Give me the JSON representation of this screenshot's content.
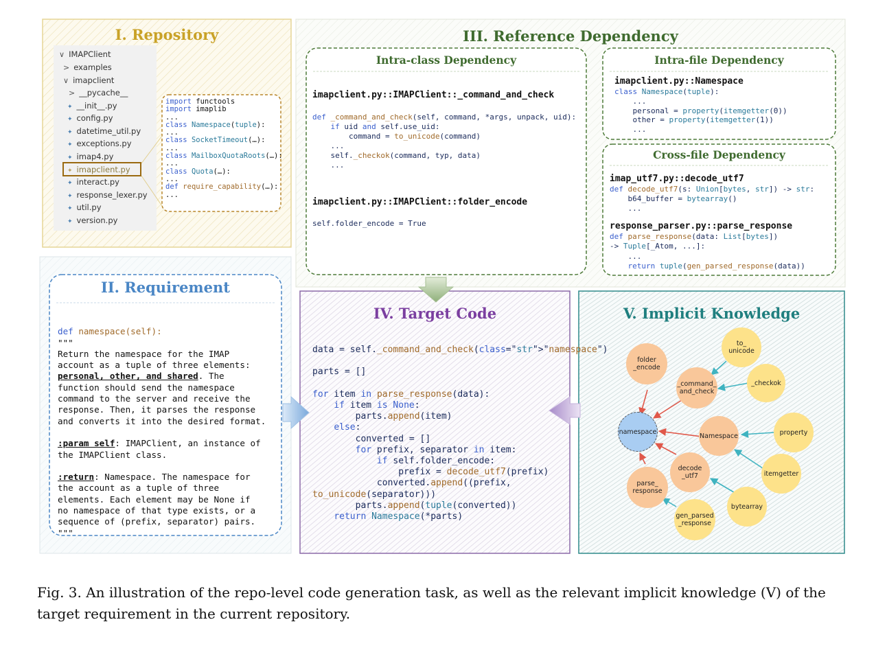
{
  "panels": {
    "repository": {
      "title": "I. Repository"
    },
    "requirement": {
      "title": "II. Requirement"
    },
    "reference": {
      "title": "III. Reference Dependency"
    },
    "target": {
      "title": "IV. Target Code"
    },
    "implicit": {
      "title": "V. Implicit Knowledge"
    }
  },
  "repo_tree": [
    {
      "label": "IMAPClient",
      "prefix": "∨"
    },
    {
      "label": "examples",
      "prefix": ">"
    },
    {
      "label": "imapclient",
      "prefix": "∨"
    },
    {
      "label": "__pycache__",
      "prefix": ">"
    },
    {
      "label": "__init__.py",
      "prefix": "✦"
    },
    {
      "label": "config.py",
      "prefix": "✦"
    },
    {
      "label": "datetime_util.py",
      "prefix": "✦"
    },
    {
      "label": "exceptions.py",
      "prefix": "✦"
    },
    {
      "label": "imap4.py",
      "prefix": "✦"
    },
    {
      "label": "imapclient.py",
      "prefix": "✦"
    },
    {
      "label": "interact.py",
      "prefix": "✦"
    },
    {
      "label": "response_lexer.py",
      "prefix": "✦"
    },
    {
      "label": "util.py",
      "prefix": "✦"
    },
    {
      "label": "version.py",
      "prefix": "✦"
    }
  ],
  "repo_preview": [
    "import functools",
    "import imaplib",
    "...",
    "class Namespace(tuple):",
    "...",
    "class SocketTimeout(…):",
    "...",
    "class MailboxQuotaRoots(…):",
    "...",
    "class Quota(…):",
    "...",
    "def require_capability(…):",
    "..."
  ],
  "intra_class": {
    "title": "Intra-class Dependency",
    "heading1": "imapclient.py::IMAPClient::_command_and_check",
    "code1": [
      "def _command_and_check(self, command, *args, unpack, uid):",
      "    if uid and self.use_uid:",
      "        command = to_unicode(command)",
      "    ...",
      "    self._checkok(command, typ, data)",
      "    ..."
    ],
    "heading2": "imapclient.py::IMAPClient::folder_encode",
    "code2": "self.folder_encode = True"
  },
  "intra_file": {
    "title": "Intra-file Dependency",
    "heading": "imapclient.py::Namespace",
    "code": [
      "class Namespace(tuple):",
      "    ...",
      "    personal = property(itemgetter(0))",
      "    other = property(itemgetter(1))",
      "    ..."
    ]
  },
  "cross_file": {
    "title": "Cross-file Dependency",
    "heading1": "imap_utf7.py::decode_utf7",
    "code1": [
      "def decode_utf7(s: Union[bytes, str]) -> str:",
      "    b64_buffer = bytearray()",
      "    ..."
    ],
    "heading2": "response_parser.py::parse_response",
    "code2": [
      "def parse_response(data: List[bytes])",
      "-> Tuple[_Atom, ...]:",
      "    ...",
      "    return tuple(gen_parsed_response(data))"
    ]
  },
  "requirement": {
    "sig": "def namespace(self):",
    "quote_open": "\"\"\"",
    "desc_pre": "Return the namespace for the IMAP\naccount as a tuple of three elements:",
    "desc_bold": "personal, other, and shared",
    "desc_post": ". The\nfunction should send the namespace\ncommand to the server and receive the\nresponse. Then, it parses the response\nand converts it into the desired format.",
    "param_label": ":param self",
    "param_text": ": IMAPClient, an instance of\nthe IMAPClient class.",
    "return_label": ":return",
    "return_text": ": Namespace. The namespace for\nthe account as a tuple of three\nelements. Each element may be None if\nno namespace of that type exists, or a\nsequence of (prefix, separator) pairs.",
    "quote_close": "\"\"\""
  },
  "target_code": [
    "data = self._command_and_check(\"namespace\")",
    "",
    "parts = []",
    "",
    "for item in parse_response(data):",
    "    if item is None:",
    "        parts.append(item)",
    "    else:",
    "        converted = []",
    "        for prefix, separator in item:",
    "            if self.folder_encode:",
    "                prefix = decode_utf7(prefix)",
    "            converted.append((prefix,",
    "to_unicode(separator)))",
    "        parts.append(tuple(converted))",
    "    return Namespace(*parts)"
  ],
  "graph_nodes": {
    "folder_encode": "folder\n_encode",
    "to_unicode": "to_\nunicode",
    "command_and_check": "_command_\nand_check",
    "checkok": "_checkok",
    "namespace": "namespace",
    "Namespace": "Namespace",
    "property": "property",
    "decode_utf7": "decode\n_utf7",
    "itemgetter": "itemgetter",
    "parse_response": "parse_\nresponse",
    "bytearray": "bytearray",
    "gen_parsed_response": "gen_parsed\n_response"
  },
  "caption": "Fig. 3.  An illustration of the repo-level code generation task, as well as the relevant implicit knowledge (V) of the target requirement in the current repository.",
  "colors": {
    "repo": "#c9a227",
    "requirement": "#4a86c5",
    "reference": "#3f6b2f",
    "target": "#7b3fa0",
    "implicit": "#1f7f7f",
    "edge_red": "#e0584a",
    "edge_teal": "#3fb3c0"
  }
}
